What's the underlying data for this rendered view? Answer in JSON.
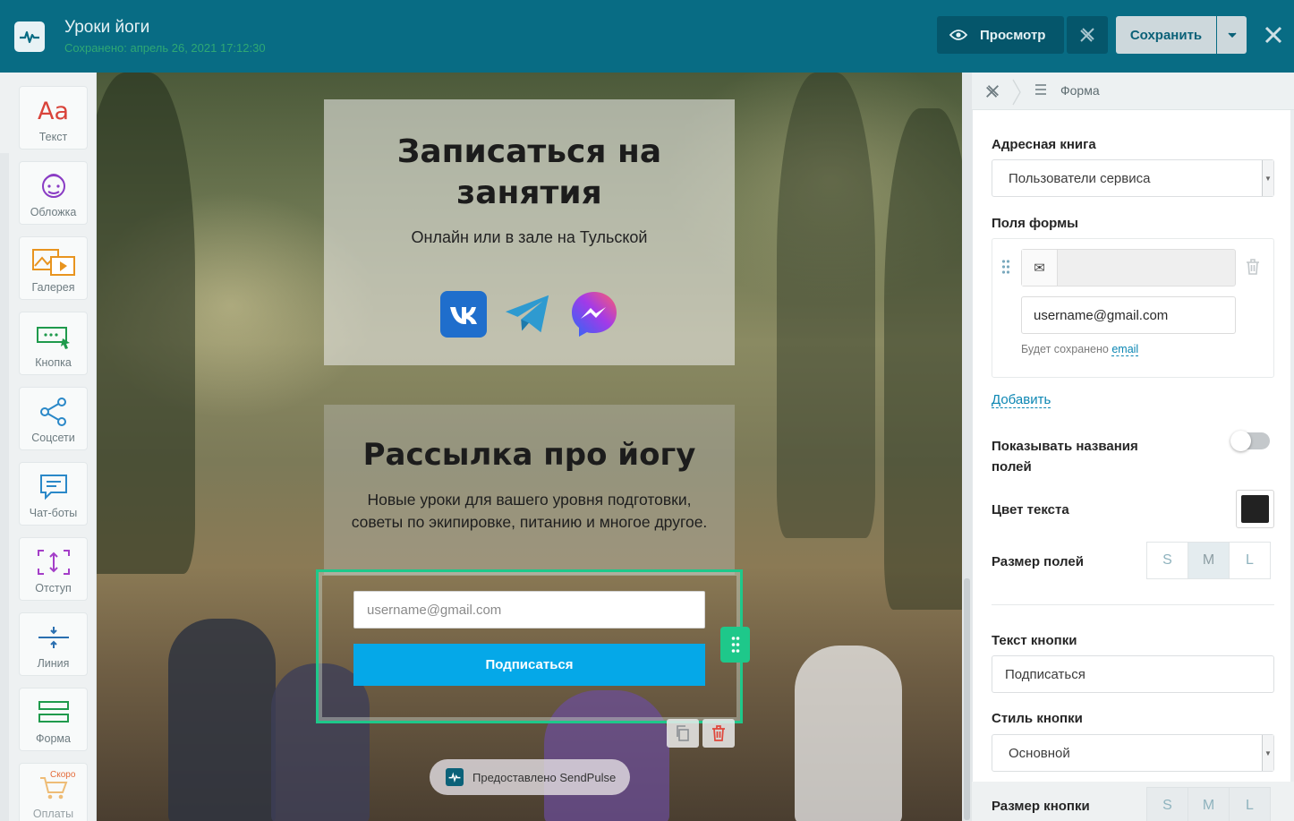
{
  "header": {
    "title": "Уроки йоги",
    "saved": "Сохранено: апрель 26, 2021 17:12:30",
    "preview_label": "Просмотр",
    "save_label": "Сохранить"
  },
  "sidebar": {
    "items": [
      {
        "label": "Текст",
        "icon": "text-icon"
      },
      {
        "label": "Обложка",
        "icon": "cover-icon"
      },
      {
        "label": "Галерея",
        "icon": "gallery-icon"
      },
      {
        "label": "Кнопка",
        "icon": "button-icon"
      },
      {
        "label": "Соцсети",
        "icon": "share-icon"
      },
      {
        "label": "Чат-боты",
        "icon": "chat-icon"
      },
      {
        "label": "Отступ",
        "icon": "spacing-icon"
      },
      {
        "label": "Линия",
        "icon": "line-icon"
      },
      {
        "label": "Форма",
        "icon": "form-icon"
      },
      {
        "label": "Оплаты",
        "icon": "cart-icon"
      }
    ],
    "soon": "Скоро"
  },
  "canvas": {
    "block1": {
      "title": "Записаться на занятия",
      "subtitle": "Онлайн или в зале на Тульской",
      "socials": [
        "vk-icon",
        "telegram-icon",
        "messenger-icon"
      ]
    },
    "block2": {
      "title": "Рассылка про йогу",
      "subtitle": "Новые уроки для вашего уровня подготовки, советы по экипировке, питанию и многое другое."
    },
    "form": {
      "email_placeholder": "username@gmail.com",
      "submit_label": "Подписаться"
    },
    "badge": "Предоставлено SendPulse"
  },
  "panel": {
    "breadcrumb": "Форма",
    "address_book_label": "Адресная книга",
    "address_book_value": "Пользователи сервиса",
    "fields_label": "Поля формы",
    "field_placeholder": "username@gmail.com",
    "field_note": "Будет сохранено",
    "field_note_link": "email",
    "add_label": "Добавить",
    "show_names_label": "Показывать названия полей",
    "text_color_label": "Цвет текста",
    "text_color": "#222222",
    "field_size_label": "Размер полей",
    "sizes": [
      "S",
      "M",
      "L"
    ],
    "selected_size": "M",
    "button_text_label": "Текст кнопки",
    "button_text_value": "Подписаться",
    "button_style_label": "Стиль кнопки",
    "button_style_value": "Основной",
    "button_size_label": "Размер кнопки"
  },
  "colors": {
    "topbar": "#086c84",
    "accent_green": "#1ec88a",
    "button_blue": "#05a8e8"
  }
}
